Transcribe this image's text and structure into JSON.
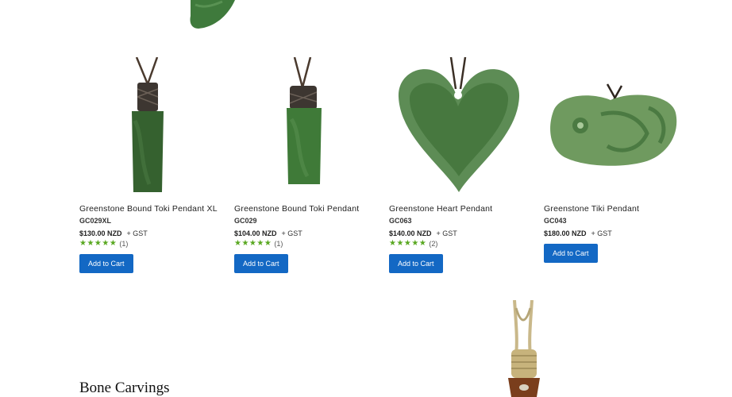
{
  "products": [
    {
      "title": "Greenstone Bound Toki Pendant XL",
      "sku": "GC029XL",
      "price": "$130.00 NZD",
      "tax": "+ GST",
      "stars": "★★★★★",
      "reviews": "(1)",
      "button": "Add to Cart"
    },
    {
      "title": "Greenstone Bound Toki Pendant",
      "sku": "GC029",
      "price": "$104.00 NZD",
      "tax": "+ GST",
      "stars": "★★★★★",
      "reviews": "(1)",
      "button": "Add to Cart"
    },
    {
      "title": "Greenstone Heart Pendant",
      "sku": "GC063",
      "price": "$140.00 NZD",
      "tax": "+ GST",
      "stars": "★★★★★",
      "reviews": "(2)",
      "button": "Add to Cart"
    },
    {
      "title": "Greenstone Tiki Pendant",
      "sku": "GC043",
      "price": "$180.00 NZD",
      "tax": "+ GST",
      "button": "Add to Cart"
    }
  ],
  "section": {
    "bone_heading": "Bone Carvings"
  },
  "colors": {
    "button": "#1368c4",
    "stars": "#59a821",
    "jade": "#3f7a3c"
  }
}
